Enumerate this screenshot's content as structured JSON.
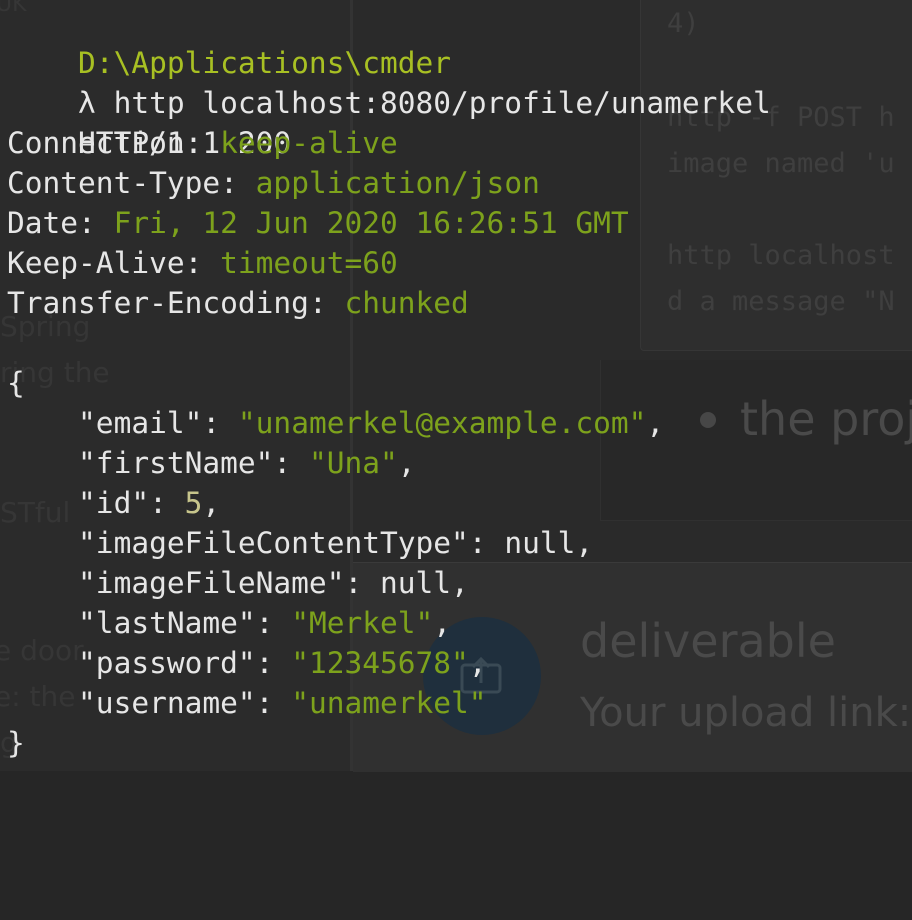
{
  "background": {
    "left_fragments": [
      "UK",
      "Spring",
      "ring the",
      "STful",
      "e door",
      "e: the",
      "g"
    ],
    "code_line_1": "4)",
    "code_line_2": "http -f POST h",
    "code_line_3": "image named 'u",
    "code_line_4": "http localhost",
    "code_line_5": "d a message \"N",
    "bullet_text": "the proj",
    "section_heading": "deliverable",
    "section_subtext": "Your upload link:",
    "avatar_icon": "upload-icon"
  },
  "terminal": {
    "cwd": "D:\\Applications\\cmder",
    "prompt_symbol": "λ",
    "command": "http localhost:8080/profile/unamerkel",
    "status_line": "HTTP/1.1 200",
    "headers": [
      {
        "key": "Connection",
        "value": "keep-alive"
      },
      {
        "key": "Content-Type",
        "value": "application/json"
      },
      {
        "key": "Date",
        "value": "Fri, 12 Jun 2020 16:26:51 GMT"
      },
      {
        "key": "Keep-Alive",
        "value": "timeout=60"
      },
      {
        "key": "Transfer-Encoding",
        "value": "chunked"
      }
    ],
    "open_brace": "{",
    "close_brace": "}",
    "json_fields": [
      {
        "key": "\"email\"",
        "value": "\"unamerkel@example.com\"",
        "type": "string",
        "trail": ","
      },
      {
        "key": "\"firstName\"",
        "value": "\"Una\"",
        "type": "string",
        "trail": ","
      },
      {
        "key": "\"id\"",
        "value": "5",
        "type": "number",
        "trail": ","
      },
      {
        "key": "\"imageFileContentType\"",
        "value": "null",
        "type": "null",
        "trail": ","
      },
      {
        "key": "\"imageFileName\"",
        "value": "null",
        "type": "null",
        "trail": ","
      },
      {
        "key": "\"lastName\"",
        "value": "\"Merkel\"",
        "type": "string",
        "trail": ","
      },
      {
        "key": "\"password\"",
        "value": "\"12345678\"",
        "type": "string",
        "trail": ","
      },
      {
        "key": "\"username\"",
        "value": "\"unamerkel\"",
        "type": "string",
        "trail": ""
      }
    ]
  },
  "colors": {
    "background": "#262626",
    "path": "#a8c023",
    "value_green": "#7da21c",
    "number": "#c7c58c",
    "foreground": "#e6e6e6"
  }
}
